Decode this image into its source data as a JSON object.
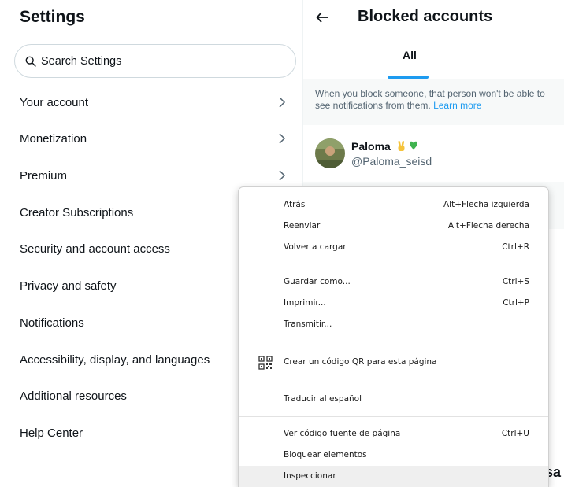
{
  "settings": {
    "title": "Settings",
    "search_placeholder": "Search Settings",
    "items": [
      {
        "label": "Your account",
        "chevron": true
      },
      {
        "label": "Monetization",
        "chevron": true
      },
      {
        "label": "Premium",
        "chevron": true
      },
      {
        "label": "Creator Subscriptions",
        "chevron": false
      },
      {
        "label": "Security and account access",
        "chevron": false
      },
      {
        "label": "Privacy and safety",
        "chevron": false
      },
      {
        "label": "Notifications",
        "chevron": false
      },
      {
        "label": "Accessibility, display, and languages",
        "chevron": false
      },
      {
        "label": "Additional resources",
        "chevron": false
      },
      {
        "label": "Help Center",
        "chevron": false
      }
    ]
  },
  "blocked": {
    "title": "Blocked accounts",
    "tab_all": "All",
    "info_line1": "When you block someone, that person won't be able to",
    "info_line2": "see notifications from them.",
    "learn_more": "Learn more",
    "user": {
      "name": "Paloma",
      "handle": "@Paloma_seisd"
    },
    "trailing_text": "sa"
  },
  "context_menu": {
    "items": [
      {
        "label": "Atrás",
        "shortcut": "Alt+Flecha izquierda"
      },
      {
        "label": "Reenviar",
        "shortcut": "Alt+Flecha derecha"
      },
      {
        "label": "Volver a cargar",
        "shortcut": "Ctrl+R"
      },
      {
        "label": "Guardar como...",
        "shortcut": "Ctrl+S"
      },
      {
        "label": "Imprimir...",
        "shortcut": "Ctrl+P"
      },
      {
        "label": "Transmitir...",
        "shortcut": ""
      },
      {
        "label": "Crear un código QR para esta página",
        "shortcut": ""
      },
      {
        "label": "Traducir al español",
        "shortcut": ""
      },
      {
        "label": "Ver código fuente de página",
        "shortcut": "Ctrl+U"
      },
      {
        "label": "Bloquear elementos",
        "shortcut": ""
      },
      {
        "label": "Inspeccionar",
        "shortcut": ""
      }
    ]
  },
  "colors": {
    "accent": "#1d9bf0",
    "text_primary": "#0f1419",
    "text_secondary": "#536471",
    "menu_hover": "#efefef"
  }
}
